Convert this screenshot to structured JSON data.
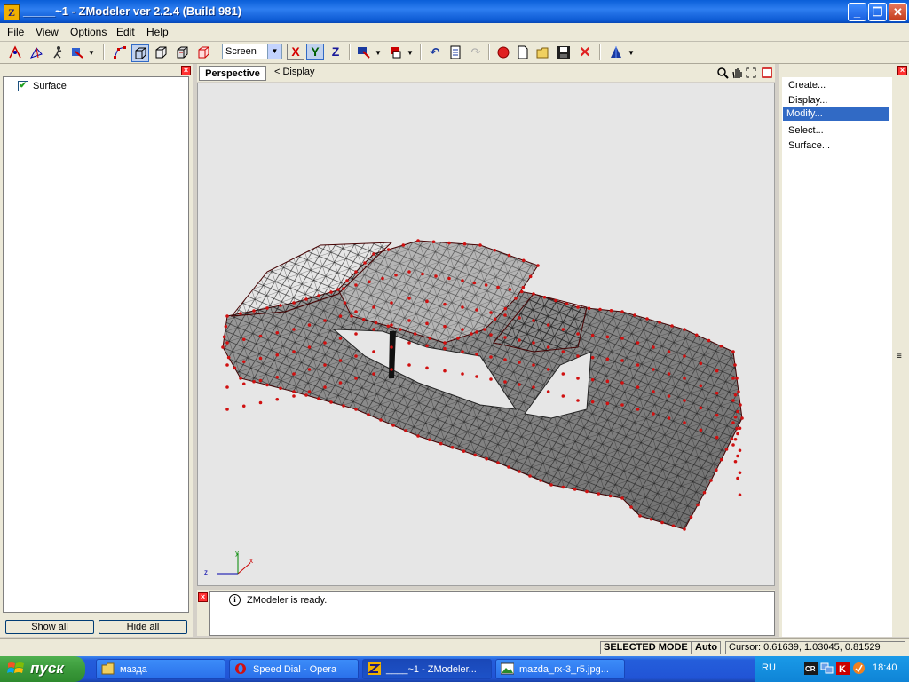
{
  "window": {
    "title": "_____~1 - ZModeler ver 2.2.4 (Build 981)",
    "minimize": "_",
    "maximize": "❐",
    "close": "✕",
    "app_icon_letter": "Z"
  },
  "menu": [
    "File",
    "View",
    "Options",
    "Edit",
    "Help"
  ],
  "toolbar": {
    "coordinate_mode": "Screen",
    "axes": [
      "X",
      "Y",
      "Z"
    ],
    "axis_colors": {
      "X": "#d40000",
      "Y": "#006000",
      "Z": "#1a1a9a"
    }
  },
  "left_panel": {
    "tree": [
      {
        "label": "Surface",
        "checked": true
      }
    ],
    "show_all": "Show all",
    "hide_all": "Hide all"
  },
  "viewport": {
    "tab_active": "Perspective",
    "tab_display": "< Display",
    "axis_labels": {
      "x": "x",
      "y": "y",
      "z": "z"
    }
  },
  "log": {
    "message": "ZModeler is ready."
  },
  "right_panel": {
    "items": [
      "Create...",
      "Display...",
      "Modify...",
      "Select...",
      "Surface..."
    ],
    "selected_index": 2
  },
  "status": {
    "mode": "SELECTED MODE",
    "auto": "Auto",
    "cursor": "Cursor: 0.61639, 1.03045, 0.81529"
  },
  "taskbar": {
    "start_label": "пуск",
    "tasks": [
      {
        "label": "мазда",
        "active": false
      },
      {
        "label": "Speed Dial - Opera",
        "active": false
      },
      {
        "label": "____~1 - ZModeler...",
        "active": true
      },
      {
        "label": "mazda_rx-3_r5.jpg...",
        "active": false
      }
    ],
    "language": "RU",
    "clock": "18:40"
  }
}
